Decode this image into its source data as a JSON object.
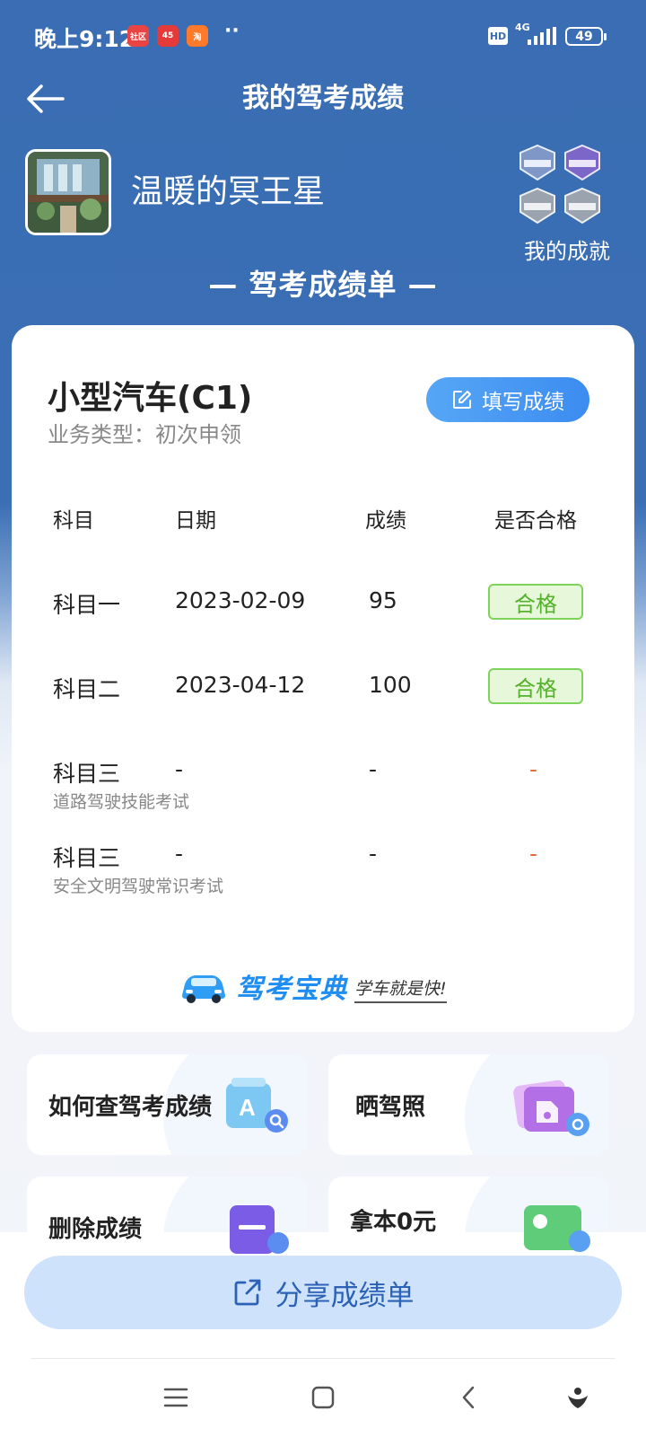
{
  "status_bar": {
    "time": "晚上9:12",
    "app_icons": [
      {
        "name": "app-icon-1",
        "text": "社区",
        "color": "#e84444"
      },
      {
        "name": "app-icon-2",
        "text": "45",
        "color": "#e53a3a"
      },
      {
        "name": "app-icon-3",
        "text": "淘",
        "color": "#ff7a2a"
      }
    ],
    "dots": "··",
    "hd": "HD",
    "network": "4G",
    "battery": "49"
  },
  "header": {
    "title": "我的驾考成绩"
  },
  "profile": {
    "username": "温暖的冥王星",
    "achievements_label": "我的成就"
  },
  "report_heading": "— 驾考成绩单 —",
  "card": {
    "vehicle_type": "小型汽车(C1)",
    "business_type": "业务类型：初次申领",
    "fill_button": "填写成绩",
    "columns": {
      "subject": "科目",
      "date": "日期",
      "score": "成绩",
      "passed": "是否合格"
    },
    "rows": [
      {
        "subject": "科目一",
        "subtitle": "",
        "date": "2023-02-09",
        "score": "95",
        "status": "合格"
      },
      {
        "subject": "科目二",
        "subtitle": "",
        "date": "2023-04-12",
        "score": "100",
        "status": "合格"
      },
      {
        "subject": "科目三",
        "subtitle": "道路驾驶技能考试",
        "date": "-",
        "score": "-",
        "status": "-"
      },
      {
        "subject": "科目三",
        "subtitle": "安全文明驾驶常识考试",
        "date": "-",
        "score": "-",
        "status": "-"
      }
    ],
    "brand_name": "驾考宝典",
    "brand_slogan": "学车就是快!"
  },
  "tiles": [
    {
      "label": "如何查驾考成绩",
      "icon": "search-doc-icon"
    },
    {
      "label": "晒驾照",
      "icon": "photo-share-icon"
    },
    {
      "label": "删除成绩",
      "icon": "delete-doc-icon"
    },
    {
      "label": "拿本0元",
      "icon": "license-card-icon"
    }
  ],
  "bottom": {
    "share_button": "分享成绩单"
  },
  "colors": {
    "header_blue": "#3a6db3",
    "pass_green": "#55b22c",
    "fail_orange": "#e86a36",
    "button_blue": "#3c8cf1"
  }
}
